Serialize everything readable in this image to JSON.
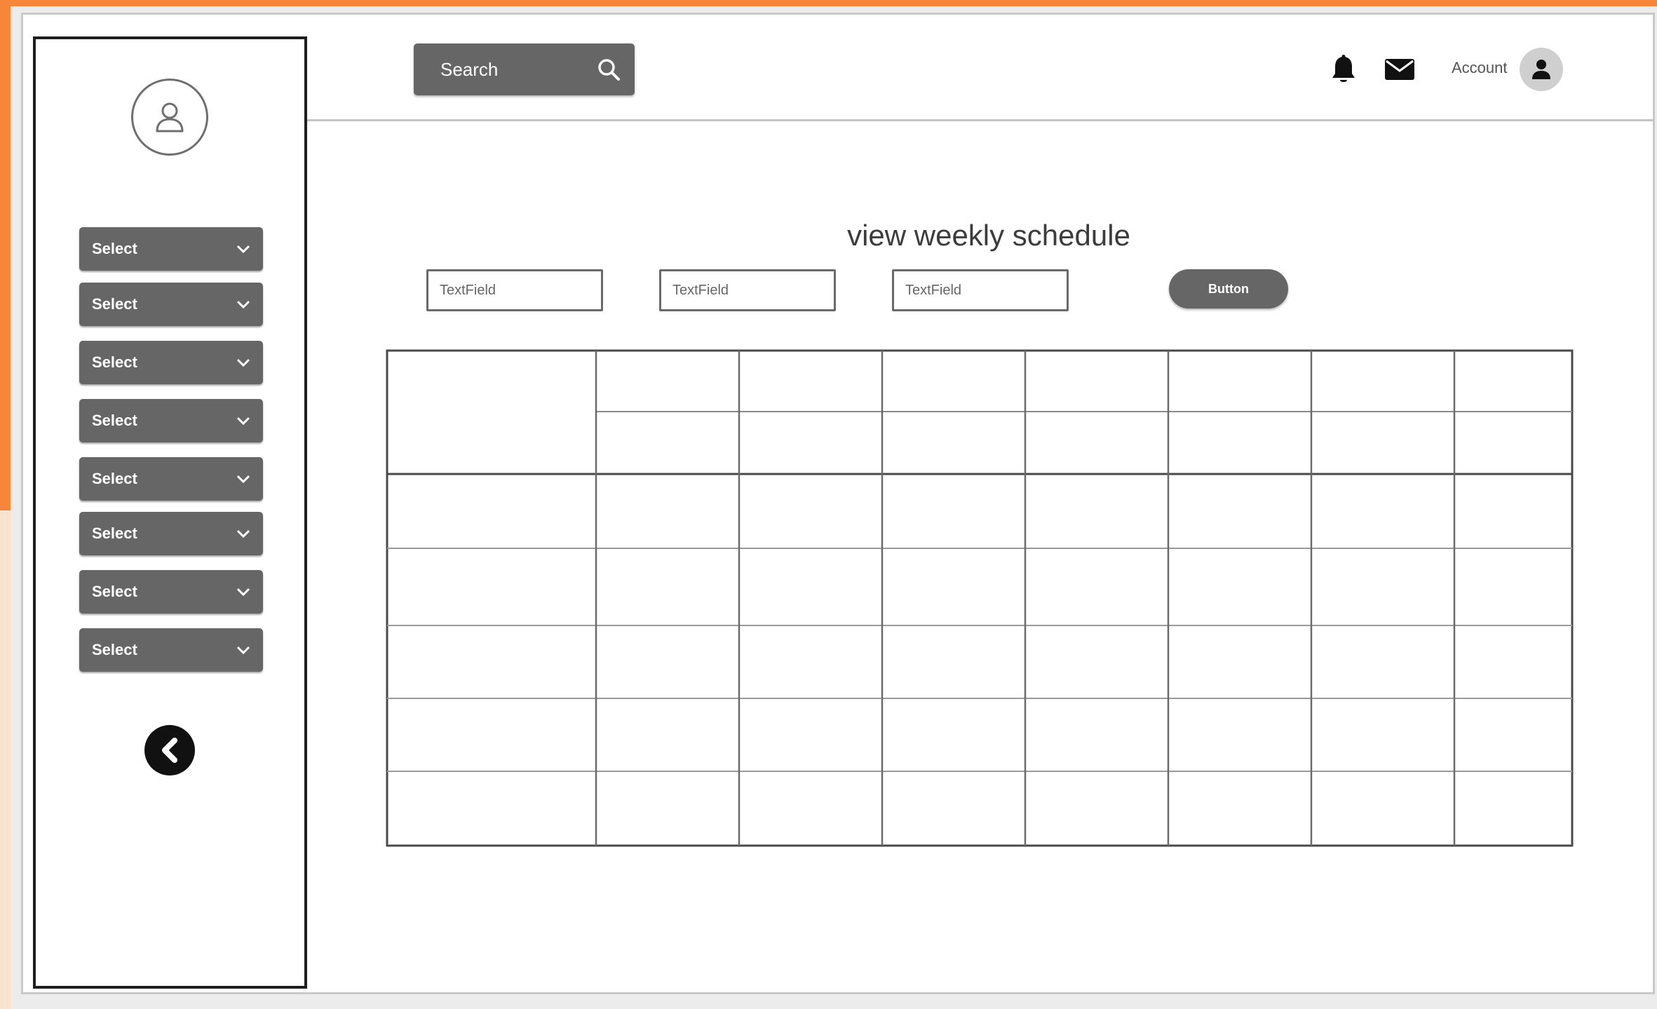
{
  "colors": {
    "accent": "#f7863b",
    "control_fill": "#666666",
    "text_dark": "#3c3c3c"
  },
  "sidebar": {
    "avatar_icon": "user-outline-icon",
    "selects": [
      {
        "label": "Select",
        "icon": "chevron-down-icon"
      },
      {
        "label": "Select",
        "icon": "chevron-down-icon"
      },
      {
        "label": "Select",
        "icon": "chevron-down-icon"
      },
      {
        "label": "Select",
        "icon": "chevron-down-icon"
      },
      {
        "label": "Select",
        "icon": "chevron-down-icon"
      },
      {
        "label": "Select",
        "icon": "chevron-down-icon"
      },
      {
        "label": "Select",
        "icon": "chevron-down-icon"
      },
      {
        "label": "Select",
        "icon": "chevron-down-icon"
      }
    ],
    "back_icon": "chevron-left-icon"
  },
  "header": {
    "search_label": "Search",
    "search_icon": "search-icon",
    "notification_icon": "bell-icon",
    "mail_icon": "envelope-icon",
    "account_label": "Account",
    "account_icon": "user-icon"
  },
  "main": {
    "title": "view weekly schedule",
    "text_fields": [
      {
        "placeholder": "TextField"
      },
      {
        "placeholder": "TextField"
      },
      {
        "placeholder": "TextField"
      }
    ],
    "button_label": "Button",
    "schedule_table": {
      "columns": 8,
      "header_sub_rows": 2,
      "body_rows": 5,
      "cells_empty": true
    }
  }
}
